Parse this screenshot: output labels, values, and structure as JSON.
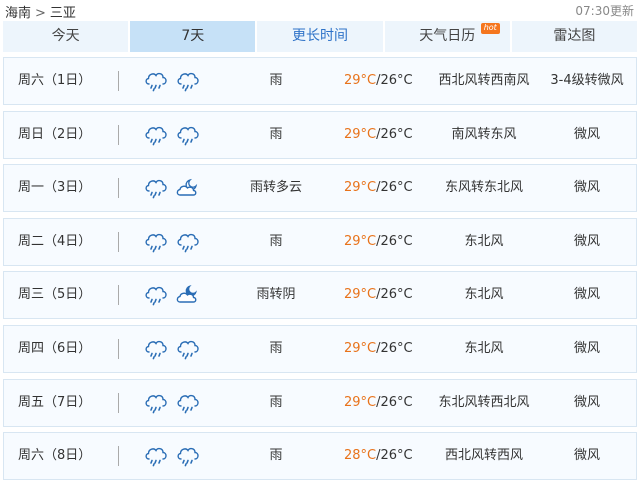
{
  "breadcrumb": {
    "province": "海南",
    "separator": ">",
    "city": "三亚"
  },
  "updated": "07:30更新",
  "tabs": [
    {
      "label": "今天"
    },
    {
      "label": "7天"
    },
    {
      "label": "更长时间"
    },
    {
      "label": "天气日历",
      "badge": "hot"
    },
    {
      "label": "雷达图"
    }
  ],
  "forecast": [
    {
      "day": "周六（1日）",
      "icons": [
        "rain-cloud-icon",
        "rain-cloud-icon"
      ],
      "weather": "雨",
      "high": "29°C",
      "sep": "/",
      "low": "26°C",
      "wind": "西北风转西南风",
      "level": "3-4级转微风"
    },
    {
      "day": "周日（2日）",
      "icons": [
        "rain-cloud-icon",
        "rain-cloud-icon"
      ],
      "weather": "雨",
      "high": "29°C",
      "sep": "/",
      "low": "26°C",
      "wind": "南风转东风",
      "level": "微风"
    },
    {
      "day": "周一（3日）",
      "icons": [
        "rain-cloud-icon",
        "partly-cloudy-moon-icon"
      ],
      "weather": "雨转多云",
      "high": "29°C",
      "sep": "/",
      "low": "26°C",
      "wind": "东风转东北风",
      "level": "微风"
    },
    {
      "day": "周二（4日）",
      "icons": [
        "rain-cloud-icon",
        "rain-cloud-icon"
      ],
      "weather": "雨",
      "high": "29°C",
      "sep": "/",
      "low": "26°C",
      "wind": "东北风",
      "level": "微风"
    },
    {
      "day": "周三（5日）",
      "icons": [
        "rain-cloud-icon",
        "overcast-moon-icon"
      ],
      "weather": "雨转阴",
      "high": "29°C",
      "sep": "/",
      "low": "26°C",
      "wind": "东北风",
      "level": "微风"
    },
    {
      "day": "周四（6日）",
      "icons": [
        "rain-cloud-icon",
        "rain-cloud-icon"
      ],
      "weather": "雨",
      "high": "29°C",
      "sep": "/",
      "low": "26°C",
      "wind": "东北风",
      "level": "微风"
    },
    {
      "day": "周五（7日）",
      "icons": [
        "rain-cloud-icon",
        "rain-cloud-icon"
      ],
      "weather": "雨",
      "high": "29°C",
      "sep": "/",
      "low": "26°C",
      "wind": "东北风转西北风",
      "level": "微风"
    },
    {
      "day": "周六（8日）",
      "icons": [
        "rain-cloud-icon",
        "rain-cloud-icon"
      ],
      "weather": "雨",
      "high": "28°C",
      "sep": "/",
      "low": "26°C",
      "wind": "西北风转西风",
      "level": "微风"
    }
  ],
  "colors": {
    "high_temp": "#e8731b",
    "active_tab": "#c6e1f7",
    "tab_bg": "#edf5fc",
    "link": "#2f73c8",
    "hot_badge": "#f5761e",
    "icon_stroke": "#2a6db5"
  }
}
